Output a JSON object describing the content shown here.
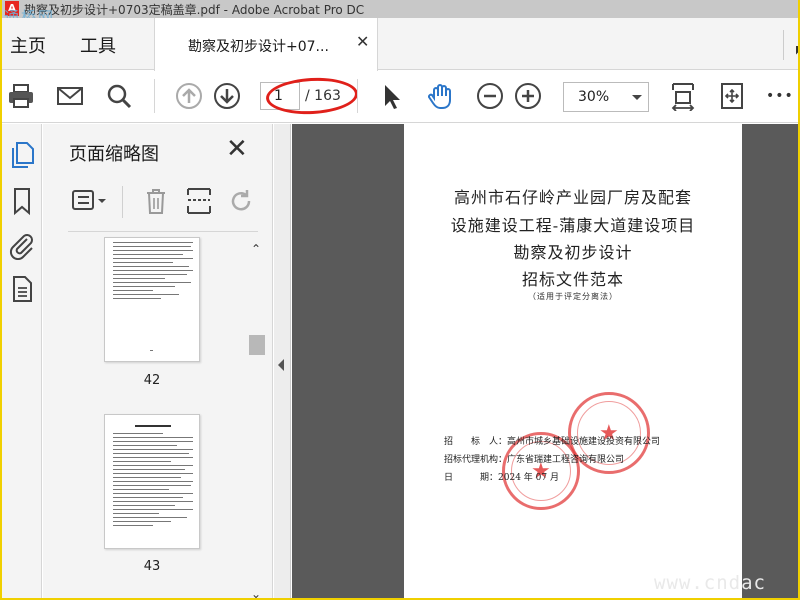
{
  "window": {
    "title": "勘察及初步设计+0703定稿盖章.pdf - Adobe Acrobat Pro DC"
  },
  "watermark_top": "通桥网",
  "watermark_bottom": "www.cndac",
  "tabs": {
    "home": "主页",
    "tools": "工具",
    "document": "勘察及初步设计+07..."
  },
  "toolbar": {
    "page_current": "1",
    "page_total": "/ 163",
    "zoom": "30%",
    "more": "•••",
    "icons": [
      "print-icon",
      "email-icon",
      "search-icon",
      "prev-page-icon",
      "next-page-icon",
      "select-cursor-icon",
      "hand-tool-icon",
      "zoom-out-icon",
      "zoom-in-icon",
      "fit-page-icon",
      "rotate-view-icon",
      "more-icon"
    ]
  },
  "left_rail": {
    "icons": [
      "page-thumbnails-icon",
      "bookmarks-icon",
      "attachments-icon",
      "document-icon"
    ]
  },
  "thumbnails_panel": {
    "title": "页面缩略图",
    "pages": [
      {
        "number": "42"
      },
      {
        "number": "43"
      }
    ]
  },
  "document_page": {
    "title_lines": [
      "高州市石仔岭产业园厂房及配套",
      "设施建设工程-蒲康大道建设项目",
      "勘察及初步设计",
      "招标文件范本"
    ],
    "subtitle": "（适用于评定分离法）",
    "info": [
      {
        "label": "招　　标　人：",
        "value": "高州市城乡基础设施建设投资有限公司"
      },
      {
        "label": "招标代理机构：",
        "value": "广东省瑞建工程咨询有限公司"
      },
      {
        "label": "日　　　期：",
        "value": "2024 年 07 月"
      }
    ]
  },
  "colors": {
    "annotation_ellipse": "#e0201a",
    "stamp": "#e23c3c",
    "tool_blue": "#2b76c9",
    "doc_background": "#5a5a5a"
  }
}
